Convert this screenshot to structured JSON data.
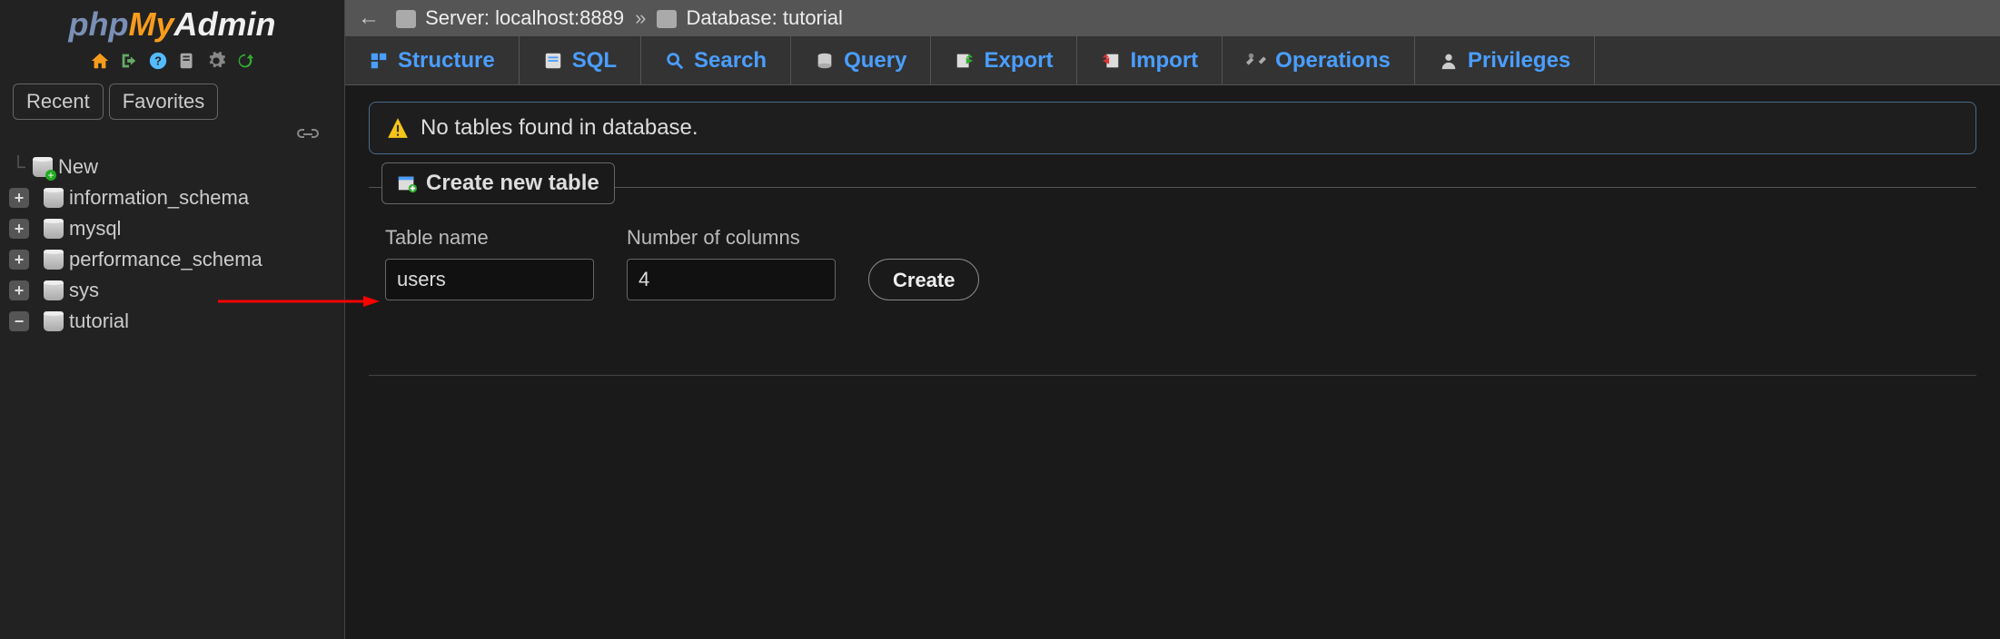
{
  "logo": {
    "php": "php",
    "my": "My",
    "admin": "Admin"
  },
  "sidebar": {
    "tabs": {
      "recent": "Recent",
      "favorites": "Favorites"
    },
    "nodes": {
      "new": "New",
      "items": [
        "information_schema",
        "mysql",
        "performance_schema",
        "sys",
        "tutorial"
      ]
    }
  },
  "breadcrumb": {
    "server_label": "Server:",
    "server_value": "localhost:8889",
    "database_label": "Database:",
    "database_value": "tutorial"
  },
  "tabs": {
    "structure": "Structure",
    "sql": "SQL",
    "search": "Search",
    "query": "Query",
    "export": "Export",
    "import": "Import",
    "operations": "Operations",
    "privileges": "Privileges"
  },
  "notice": {
    "text": "No tables found in database."
  },
  "create_section": {
    "legend": "Create new table",
    "name_label": "Table name",
    "name_value": "users",
    "cols_label": "Number of columns",
    "cols_value": "4",
    "button": "Create"
  }
}
